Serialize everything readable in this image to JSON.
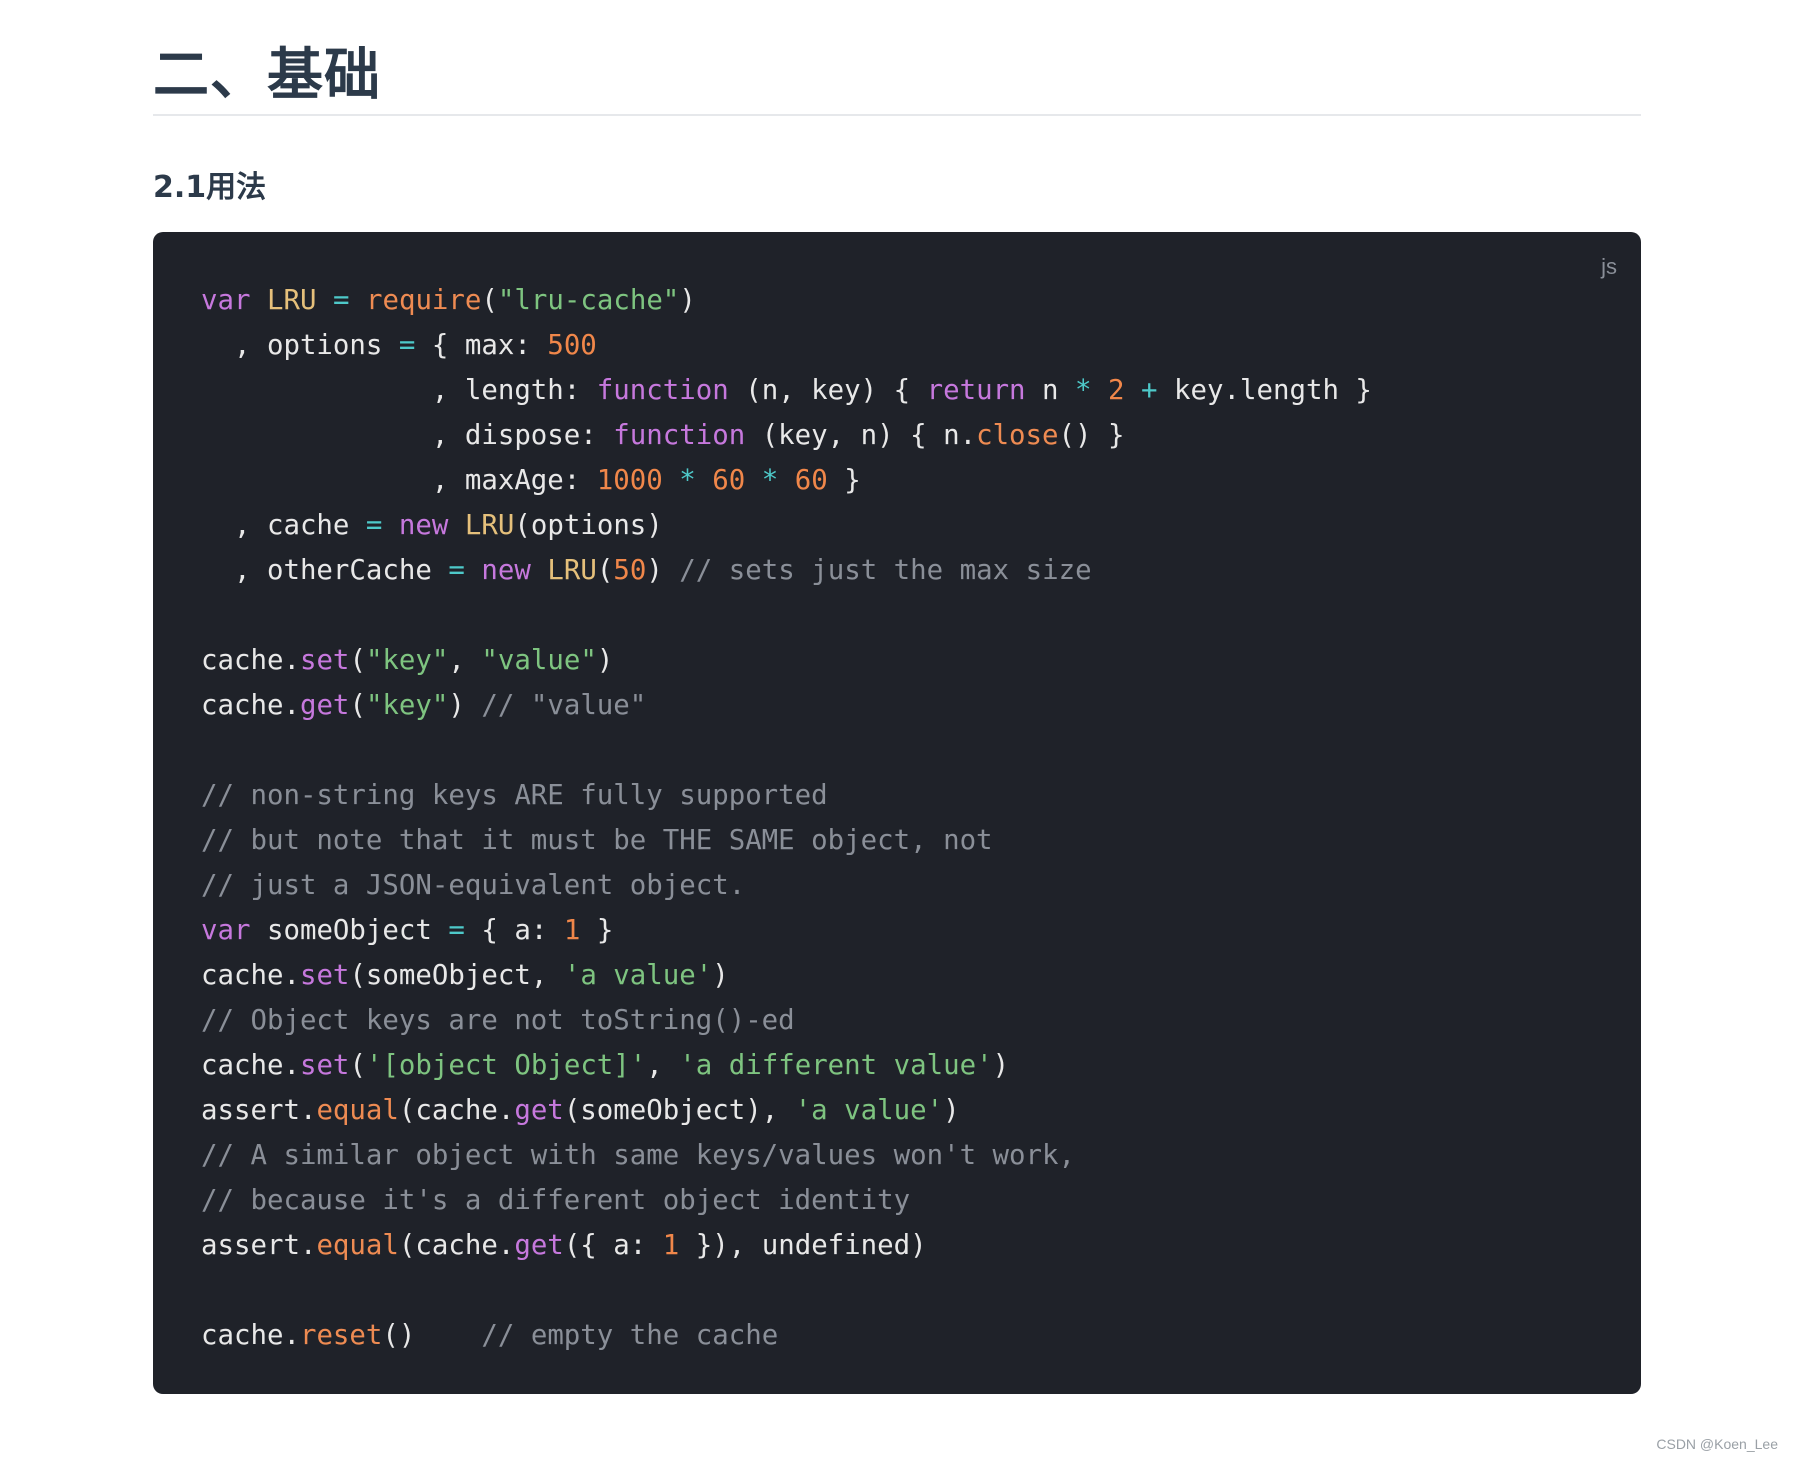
{
  "article": {
    "heading": "二、基础",
    "subheading": "2.1用法"
  },
  "code_block": {
    "language": "js",
    "lines": [
      [
        [
          "kw",
          "var"
        ],
        [
          "pl",
          " "
        ],
        [
          "cls",
          "LRU"
        ],
        [
          "pl",
          " "
        ],
        [
          "op",
          "="
        ],
        [
          "pl",
          " "
        ],
        [
          "fn",
          "require"
        ],
        [
          "pl",
          "("
        ],
        [
          "str",
          "\"lru-cache\""
        ],
        [
          "pl",
          ")"
        ]
      ],
      [
        [
          "pl",
          "  , options "
        ],
        [
          "op",
          "="
        ],
        [
          "pl",
          " { max: "
        ],
        [
          "num",
          "500"
        ]
      ],
      [
        [
          "pl",
          "              , length: "
        ],
        [
          "kw",
          "function"
        ],
        [
          "pl",
          " (n, key) { "
        ],
        [
          "kw",
          "return"
        ],
        [
          "pl",
          " n "
        ],
        [
          "op",
          "*"
        ],
        [
          "pl",
          " "
        ],
        [
          "num",
          "2"
        ],
        [
          "pl",
          " "
        ],
        [
          "op",
          "+"
        ],
        [
          "pl",
          " key.length }"
        ]
      ],
      [
        [
          "pl",
          "              , dispose: "
        ],
        [
          "kw",
          "function"
        ],
        [
          "pl",
          " (key, n) { n."
        ],
        [
          "fn",
          "close"
        ],
        [
          "pl",
          "() }"
        ]
      ],
      [
        [
          "pl",
          "              , maxAge: "
        ],
        [
          "num",
          "1000"
        ],
        [
          "pl",
          " "
        ],
        [
          "op",
          "*"
        ],
        [
          "pl",
          " "
        ],
        [
          "num",
          "60"
        ],
        [
          "pl",
          " "
        ],
        [
          "op",
          "*"
        ],
        [
          "pl",
          " "
        ],
        [
          "num",
          "60"
        ],
        [
          "pl",
          " }"
        ]
      ],
      [
        [
          "pl",
          "  , cache "
        ],
        [
          "op",
          "="
        ],
        [
          "pl",
          " "
        ],
        [
          "kw",
          "new"
        ],
        [
          "pl",
          " "
        ],
        [
          "cls",
          "LRU"
        ],
        [
          "pl",
          "(options)"
        ]
      ],
      [
        [
          "pl",
          "  , otherCache "
        ],
        [
          "op",
          "="
        ],
        [
          "pl",
          " "
        ],
        [
          "kw",
          "new"
        ],
        [
          "pl",
          " "
        ],
        [
          "cls",
          "LRU"
        ],
        [
          "pl",
          "("
        ],
        [
          "num",
          "50"
        ],
        [
          "pl",
          ") "
        ],
        [
          "com",
          "// sets just the max size"
        ]
      ],
      [],
      [
        [
          "pl",
          "cache."
        ],
        [
          "kw",
          "set"
        ],
        [
          "pl",
          "("
        ],
        [
          "str",
          "\"key\""
        ],
        [
          "pl",
          ", "
        ],
        [
          "str",
          "\"value\""
        ],
        [
          "pl",
          ")"
        ]
      ],
      [
        [
          "pl",
          "cache."
        ],
        [
          "kw",
          "get"
        ],
        [
          "pl",
          "("
        ],
        [
          "str",
          "\"key\""
        ],
        [
          "pl",
          ") "
        ],
        [
          "com",
          "// \"value\""
        ]
      ],
      [],
      [
        [
          "com",
          "// non-string keys ARE fully supported"
        ]
      ],
      [
        [
          "com",
          "// but note that it must be THE SAME object, not"
        ]
      ],
      [
        [
          "com",
          "// just a JSON-equivalent object."
        ]
      ],
      [
        [
          "kw",
          "var"
        ],
        [
          "pl",
          " someObject "
        ],
        [
          "op",
          "="
        ],
        [
          "pl",
          " { a: "
        ],
        [
          "num",
          "1"
        ],
        [
          "pl",
          " }"
        ]
      ],
      [
        [
          "pl",
          "cache."
        ],
        [
          "kw",
          "set"
        ],
        [
          "pl",
          "(someObject, "
        ],
        [
          "str",
          "'a value'"
        ],
        [
          "pl",
          ")"
        ]
      ],
      [
        [
          "com",
          "// Object keys are not toString()-ed"
        ]
      ],
      [
        [
          "pl",
          "cache."
        ],
        [
          "kw",
          "set"
        ],
        [
          "pl",
          "("
        ],
        [
          "str",
          "'[object Object]'"
        ],
        [
          "pl",
          ", "
        ],
        [
          "str",
          "'a different value'"
        ],
        [
          "pl",
          ")"
        ]
      ],
      [
        [
          "pl",
          "assert."
        ],
        [
          "fn",
          "equal"
        ],
        [
          "pl",
          "(cache."
        ],
        [
          "kw",
          "get"
        ],
        [
          "pl",
          "(someObject), "
        ],
        [
          "str",
          "'a value'"
        ],
        [
          "pl",
          ")"
        ]
      ],
      [
        [
          "com",
          "// A similar object with same keys/values won't work,"
        ]
      ],
      [
        [
          "com",
          "// because it's a different object identity"
        ]
      ],
      [
        [
          "pl",
          "assert."
        ],
        [
          "fn",
          "equal"
        ],
        [
          "pl",
          "(cache."
        ],
        [
          "kw",
          "get"
        ],
        [
          "pl",
          "({ a: "
        ],
        [
          "num",
          "1"
        ],
        [
          "pl",
          " }), undefined)"
        ]
      ],
      [],
      [
        [
          "pl",
          "cache."
        ],
        [
          "fn",
          "reset"
        ],
        [
          "pl",
          "()    "
        ],
        [
          "com",
          "// empty the cache"
        ]
      ]
    ]
  },
  "watermark": "CSDN @Koen_Lee"
}
